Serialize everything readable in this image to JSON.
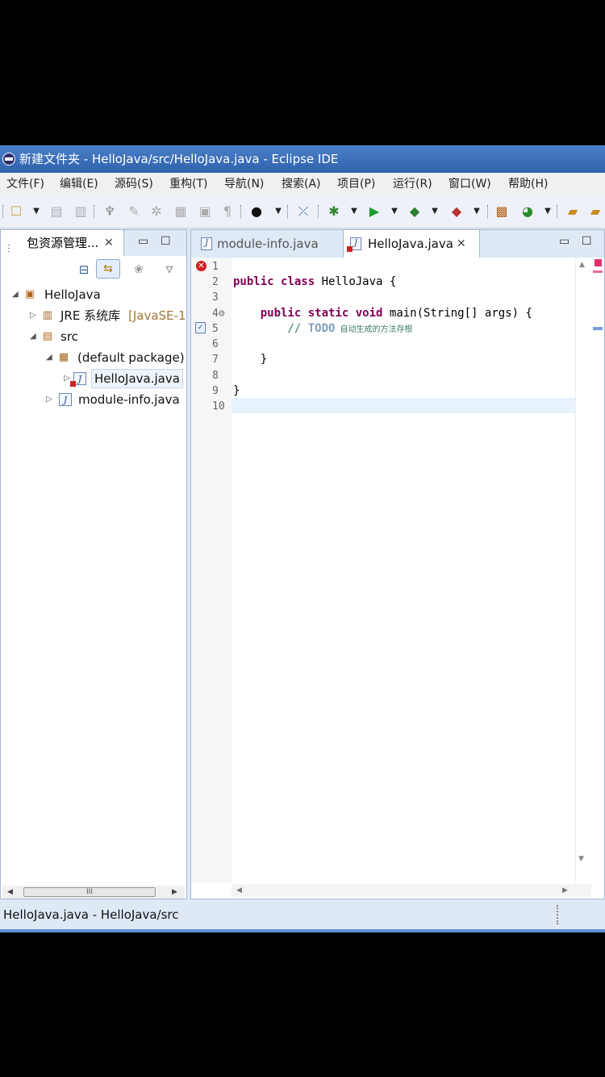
{
  "window": {
    "title": "新建文件夹 - HelloJava/src/HelloJava.java - Eclipse IDE"
  },
  "menu": [
    "文件(F)",
    "编辑(E)",
    "源码(S)",
    "重构(T)",
    "导航(N)",
    "搜索(A)",
    "项目(P)",
    "运行(R)",
    "窗口(W)",
    "帮助(H)"
  ],
  "package_explorer": {
    "tab_label": "包资源管理...",
    "tree": {
      "project": "HelloJava",
      "jre": "JRE 系统库",
      "jre_suffix": "[JavaSE-1",
      "src": "src",
      "package": "(default package)",
      "file_main": "HelloJava.java",
      "file_module": "module-info.java"
    },
    "scroll_thumb_label": "III"
  },
  "editor": {
    "tabs": [
      {
        "label": "module-info.java",
        "active": false
      },
      {
        "label": "HelloJava.java",
        "active": true
      }
    ],
    "lines": [
      {
        "n": "1",
        "text": ""
      },
      {
        "n": "2",
        "text": "public class HelloJava {"
      },
      {
        "n": "3",
        "text": ""
      },
      {
        "n": "4⊖",
        "text": "    public static void main(String[] args) {"
      },
      {
        "n": "5",
        "text": "        // TODO 自动生成的方法存根"
      },
      {
        "n": "6",
        "text": ""
      },
      {
        "n": "7",
        "text": "    }"
      },
      {
        "n": "8",
        "text": ""
      },
      {
        "n": "9",
        "text": "}"
      },
      {
        "n": "10",
        "text": ""
      }
    ],
    "code": {
      "l2_kw1": "public",
      "l2_kw2": "class",
      "l2_rest": " HelloJava {",
      "l4_kw1": "public",
      "l4_kw2": "static",
      "l4_kw3": "void",
      "l4_rest": " main(String[] args) {",
      "l5_cm": "// ",
      "l5_todo": "TODO",
      "l5_text": " 自动生成的方法存根",
      "l7": "    }",
      "l9": "}"
    }
  },
  "status": {
    "text": "HelloJava.java - HelloJava/src"
  },
  "colors": {
    "keyword": "#7f0055",
    "comment": "#3f7f5f",
    "todo": "#7f9fbf",
    "error": "#d21f1f",
    "titlebar": "#2f62ad"
  }
}
